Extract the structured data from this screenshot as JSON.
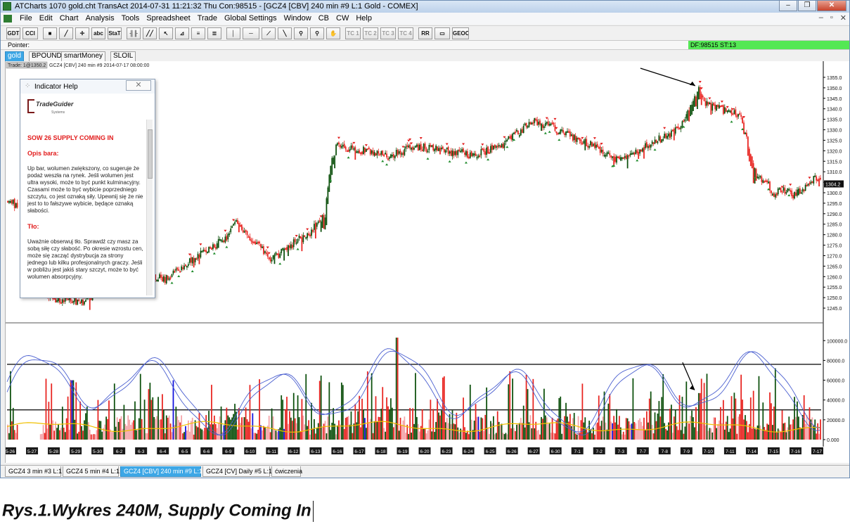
{
  "window": {
    "title": "ATCharts 1070 gold.cht  TransAct 2014-07-31  11:21:32 Thu  Con:98515 - [GCZ4 [CBV]  240 min  #9  L:1  Gold - COMEX]",
    "buttons": [
      "‒",
      "❐",
      "✕"
    ]
  },
  "menu": {
    "items": [
      "File",
      "Edit",
      "Chart",
      "Analysis",
      "Tools",
      "Spreadsheet",
      "Trade",
      "Global Settings",
      "Window",
      "CB",
      "CW",
      "Help"
    ],
    "mdi_buttons": [
      "‒",
      "▫",
      "✕"
    ]
  },
  "toolbar": {
    "buttons": [
      {
        "label": "GDT",
        "icon": ""
      },
      {
        "label": "CCI",
        "icon": ""
      },
      {
        "label": "■",
        "icon": "square-icon"
      },
      {
        "label": "╱",
        "icon": "line-draw-icon"
      },
      {
        "label": "✛",
        "icon": "crosshair-icon"
      },
      {
        "label": "abc",
        "icon": ""
      },
      {
        "label": "StaT",
        "icon": ""
      },
      {
        "label": "╢╟",
        "icon": "bars-icon"
      },
      {
        "label": "╱╱",
        "icon": "channel-icon"
      },
      {
        "label": "↖",
        "icon": "pointer-icon"
      },
      {
        "label": "⊿",
        "icon": "triangle-icon"
      },
      {
        "label": "≡",
        "icon": "fib-icon"
      },
      {
        "label": "≣",
        "icon": "levels-icon"
      },
      {
        "label": "│",
        "icon": "vertical-line-icon"
      },
      {
        "label": "─",
        "icon": "horizontal-line-icon"
      },
      {
        "label": "⟋",
        "icon": "trend-icon"
      },
      {
        "label": "╲",
        "icon": "diagonal-icon"
      },
      {
        "label": "⚲",
        "icon": "zoom-icon"
      },
      {
        "label": "⚲",
        "icon": "magnify-icon"
      },
      {
        "label": "✋",
        "icon": "hand-icon"
      },
      {
        "label": "TC 1",
        "icon": ""
      },
      {
        "label": "TC 2",
        "icon": ""
      },
      {
        "label": "TC 3",
        "icon": ""
      },
      {
        "label": "TC 4",
        "icon": ""
      },
      {
        "label": "RR",
        "icon": ""
      },
      {
        "label": "▭",
        "icon": "rectangle-icon"
      },
      {
        "label": "GEOC",
        "icon": ""
      }
    ]
  },
  "pointer": {
    "label": "Pointer:",
    "df_status": "DF:98515  ST:13",
    "df_color": "#54e854"
  },
  "chart_tabs": [
    "gold",
    "BPOUND",
    "smartMoney",
    "SLOIL"
  ],
  "chart_header": {
    "trade_box": "Trade: 1@1350.2",
    "info": "GCZ4 [CBV]  240 min  #9 2014-07-17 08:00:00"
  },
  "help": {
    "title": "Indicator Help",
    "logo_name": "TradeGuider",
    "logo_sub": "Systems",
    "heading": "SOW 26 SUPPLY COMING IN",
    "section1": "Opis bara:",
    "body1": "Up bar, wolumen zwiększony, co sugeruje że podaż weszła na rynek. Jeśli wolumen jest ultra wysoki, może to być punkt kulminacyjny. Czasami może to być wybicie poprzedniego szczytu, co jest oznaką siły. Upewnij się że nie jest to to fałszywe wybicie, będące oznaką słabości.",
    "section2": "Tło:",
    "body2": "Uważnie obserwuj tło. Sprawdź czy masz za sobą siłę czy słabość. Po okresie wzrostu cen, może się zacząć dystrybucja za strony jednego lub kilku profesjonalnych graczy. Jeśli w pobliżu jest jakiś stary szczyt, może to być wolumen absorpcyjny."
  },
  "chart_data": {
    "type": "bar",
    "price_axis": {
      "range": [
        1242,
        1358
      ],
      "ticks": [
        "1355.0",
        "1350.0",
        "1345.0",
        "1340.0",
        "1335.0",
        "1330.0",
        "1325.0",
        "1320.0",
        "1315.0",
        "1310.0",
        "1305.0",
        "1300.0",
        "1295.0",
        "1290.0",
        "1285.0",
        "1280.0",
        "1275.0",
        "1270.0",
        "1265.0",
        "1260.0",
        "1255.0",
        "1250.0",
        "1245.0"
      ],
      "last_price": "1304.2"
    },
    "volume_axis": {
      "range": [
        0,
        108000
      ],
      "ticks": [
        "100000.0",
        "80000.0",
        "60000.0",
        "40000.0",
        "20000.0",
        "0.000"
      ],
      "reference_lines": [
        76000,
        30000
      ]
    },
    "date_labels": [
      "5-26",
      "5-27",
      "5-28",
      "5-29",
      "5-30",
      "6-2",
      "6-3",
      "6-4",
      "6-5",
      "6-6",
      "6-9",
      "6-10",
      "6-11",
      "6-12",
      "6-13",
      "6-16",
      "6-17",
      "6-18",
      "6-19",
      "6-20",
      "6-23",
      "6-24",
      "6-25",
      "6-26",
      "6-27",
      "6-30",
      "7-1",
      "7-2",
      "7-3",
      "7-7",
      "7-8",
      "7-9",
      "7-10",
      "7-11",
      "7-14",
      "7-15",
      "7-16",
      "7-17"
    ],
    "price_anchors": [
      [
        0,
        1296
      ],
      [
        6,
        1294
      ],
      [
        30,
        1250
      ],
      [
        55,
        1248
      ],
      [
        65,
        1252
      ],
      [
        75,
        1257
      ],
      [
        95,
        1262
      ],
      [
        115,
        1259
      ],
      [
        130,
        1266
      ],
      [
        145,
        1272
      ],
      [
        160,
        1279
      ],
      [
        168,
        1287
      ],
      [
        175,
        1280
      ],
      [
        185,
        1274
      ],
      [
        192,
        1268
      ],
      [
        205,
        1274
      ],
      [
        220,
        1281
      ],
      [
        232,
        1290
      ],
      [
        235,
        1310
      ],
      [
        240,
        1322
      ],
      [
        260,
        1320
      ],
      [
        280,
        1318
      ],
      [
        300,
        1322
      ],
      [
        320,
        1320
      ],
      [
        340,
        1318
      ],
      [
        360,
        1322
      ],
      [
        375,
        1330
      ],
      [
        385,
        1334
      ],
      [
        400,
        1331
      ],
      [
        415,
        1326
      ],
      [
        430,
        1322
      ],
      [
        445,
        1316
      ],
      [
        460,
        1320
      ],
      [
        475,
        1325
      ],
      [
        490,
        1330
      ],
      [
        500,
        1343
      ],
      [
        505,
        1349
      ],
      [
        510,
        1342
      ],
      [
        520,
        1340
      ],
      [
        535,
        1337
      ],
      [
        540,
        1325
      ],
      [
        545,
        1311
      ],
      [
        550,
        1307
      ],
      [
        555,
        1305
      ],
      [
        560,
        1298
      ],
      [
        565,
        1302
      ],
      [
        575,
        1299
      ],
      [
        585,
        1304
      ],
      [
        590,
        1307
      ]
    ],
    "colors": {
      "up": "#0b4f0b",
      "down": "#e8231f",
      "volume_light": "#f4a3a8",
      "volume_blue": "#1010dd",
      "oscillator": "#4a5fd0",
      "avg_line": "#f0c000"
    },
    "annotations": [
      "arrow-to-high",
      "arrow-to-volume"
    ]
  },
  "bottom_tabs": [
    "GCZ4 3 min  #3  L:1",
    "GCZ4 5 min  #4  L:1",
    "GCZ4 [CBV]  240 min  #9  L:1",
    "GCZ4 [CV]  Daily  #5  L:1",
    "ćwiczenia"
  ],
  "caption": "Rys.1.Wykres 240M, Supply Coming In"
}
